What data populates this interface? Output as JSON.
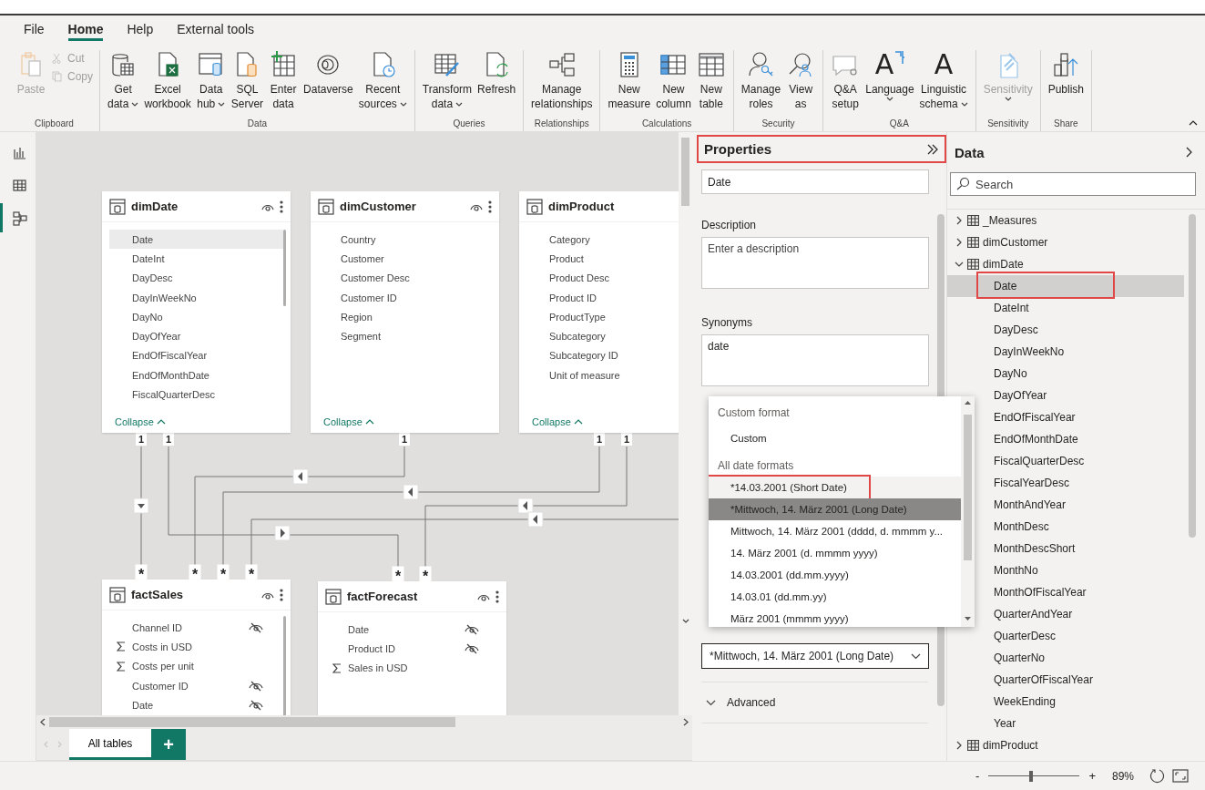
{
  "menu_tabs": [
    {
      "label": "File",
      "selected": false
    },
    {
      "label": "Home",
      "selected": true
    },
    {
      "label": "Help",
      "selected": false
    },
    {
      "label": "External tools",
      "selected": false
    }
  ],
  "ribbon": {
    "groups": [
      {
        "label": "Clipboard",
        "buttons": [
          {
            "kind": "large",
            "label": "Paste",
            "disabled": true,
            "dropdown": false
          },
          {
            "kind": "small",
            "label": "Cut",
            "disabled": true,
            "dropdown": false
          },
          {
            "kind": "small",
            "label": "Copy",
            "disabled": true,
            "dropdown": false
          }
        ]
      },
      {
        "label": "Data",
        "buttons": [
          {
            "kind": "large",
            "label": "Get\ndata",
            "disabled": false,
            "dropdown": true
          },
          {
            "kind": "large",
            "label": "Excel\nworkbook",
            "disabled": false,
            "dropdown": false
          },
          {
            "kind": "large",
            "label": "Data\nhub",
            "disabled": false,
            "dropdown": true
          },
          {
            "kind": "large",
            "label": "SQL\nServer",
            "disabled": false,
            "dropdown": false
          },
          {
            "kind": "large",
            "label": "Enter\ndata",
            "disabled": false,
            "dropdown": false
          },
          {
            "kind": "large",
            "label": "Dataverse",
            "disabled": false,
            "dropdown": false
          },
          {
            "kind": "large",
            "label": "Recent\nsources",
            "disabled": false,
            "dropdown": true
          }
        ]
      },
      {
        "label": "Queries",
        "buttons": [
          {
            "kind": "large",
            "label": "Transform\ndata",
            "disabled": false,
            "dropdown": true
          },
          {
            "kind": "large",
            "label": "Refresh",
            "disabled": false,
            "dropdown": false
          }
        ]
      },
      {
        "label": "Relationships",
        "buttons": [
          {
            "kind": "large",
            "label": "Manage\nrelationships",
            "disabled": false,
            "dropdown": false
          }
        ]
      },
      {
        "label": "Calculations",
        "buttons": [
          {
            "kind": "large",
            "label": "New\nmeasure",
            "disabled": false,
            "dropdown": false
          },
          {
            "kind": "large",
            "label": "New\ncolumn",
            "disabled": false,
            "dropdown": false
          },
          {
            "kind": "large",
            "label": "New\ntable",
            "disabled": false,
            "dropdown": false
          }
        ]
      },
      {
        "label": "Security",
        "buttons": [
          {
            "kind": "large",
            "label": "Manage\nroles",
            "disabled": false,
            "dropdown": false
          },
          {
            "kind": "large",
            "label": "View\nas",
            "disabled": false,
            "dropdown": false
          }
        ]
      },
      {
        "label": "Q&A",
        "buttons": [
          {
            "kind": "large",
            "label": "Q&A\nsetup",
            "disabled": false,
            "dropdown": false
          },
          {
            "kind": "large",
            "label": "Language",
            "disabled": false,
            "dropdown": true,
            "icon_text": "A"
          },
          {
            "kind": "large",
            "label": "Linguistic\nschema",
            "disabled": false,
            "dropdown": true,
            "icon_text": "A"
          }
        ]
      },
      {
        "label": "Sensitivity",
        "buttons": [
          {
            "kind": "large",
            "label": "Sensitivity",
            "disabled": true,
            "dropdown": true
          }
        ]
      },
      {
        "label": "Share",
        "buttons": [
          {
            "kind": "large",
            "label": "Publish",
            "disabled": false,
            "dropdown": false
          }
        ]
      }
    ]
  },
  "sidebar": {
    "views": [
      {
        "selected": false
      },
      {
        "selected": false
      },
      {
        "selected": true
      }
    ]
  },
  "diagram": {
    "tables": [
      {
        "name": "dimDate",
        "collapse_label": "Collapse",
        "fields": [
          {
            "name": "Date",
            "selected": true
          },
          {
            "name": "DateInt",
            "selected": false
          },
          {
            "name": "DayDesc",
            "selected": false
          },
          {
            "name": "DayInWeekNo",
            "selected": false
          },
          {
            "name": "DayNo",
            "selected": false
          },
          {
            "name": "DayOfYear",
            "selected": false
          },
          {
            "name": "EndOfFiscalYear",
            "selected": false
          },
          {
            "name": "EndOfMonthDate",
            "selected": false
          },
          {
            "name": "FiscalQuarterDesc",
            "selected": false
          }
        ]
      },
      {
        "name": "dimCustomer",
        "collapse_label": "Collapse",
        "fields": [
          {
            "name": "Country",
            "selected": false
          },
          {
            "name": "Customer",
            "selected": false
          },
          {
            "name": "Customer Desc",
            "selected": false
          },
          {
            "name": "Customer ID",
            "selected": false
          },
          {
            "name": "Region",
            "selected": false
          },
          {
            "name": "Segment",
            "selected": false
          }
        ]
      },
      {
        "name": "dimProduct",
        "collapse_label": "Collapse",
        "fields": [
          {
            "name": "Category",
            "selected": false
          },
          {
            "name": "Product",
            "selected": false
          },
          {
            "name": "Product Desc",
            "selected": false
          },
          {
            "name": "Product ID",
            "selected": false
          },
          {
            "name": "ProductType",
            "selected": false
          },
          {
            "name": "Subcategory",
            "selected": false
          },
          {
            "name": "Subcategory ID",
            "selected": false
          },
          {
            "name": "Unit of measure",
            "selected": false
          }
        ]
      },
      {
        "name": "factSales",
        "fields": [
          {
            "name": "Channel ID",
            "selected": false,
            "hidden": true
          },
          {
            "name": "Costs in USD",
            "selected": false,
            "sum": true
          },
          {
            "name": "Costs per unit",
            "selected": false,
            "sum": true
          },
          {
            "name": "Customer ID",
            "selected": false,
            "hidden": true
          },
          {
            "name": "Date",
            "selected": false,
            "hidden": true
          }
        ]
      },
      {
        "name": "factForecast",
        "fields": [
          {
            "name": "Date",
            "selected": false,
            "hidden": true
          },
          {
            "name": "Product ID",
            "selected": false,
            "hidden": true
          },
          {
            "name": "Sales in USD",
            "selected": false,
            "sum": true
          }
        ]
      }
    ],
    "relationships": [
      {
        "kind": "down"
      },
      {
        "kind": "right"
      },
      {
        "kind": "left"
      },
      {
        "kind": "left"
      },
      {
        "kind": "left"
      },
      {
        "kind": "left"
      }
    ],
    "one_side_labels": [
      "1",
      "1",
      "1",
      "1",
      "1"
    ],
    "many_side_labels": [
      "*",
      "*",
      "*",
      "*",
      "*",
      "*"
    ]
  },
  "page_tabs": {
    "tabs": [
      {
        "label": "All tables",
        "selected": true
      }
    ],
    "add_label": "+"
  },
  "properties": {
    "title": "Properties",
    "highlighted": true,
    "name_value": "Date",
    "description": {
      "label": "Description",
      "placeholder": "Enter a description"
    },
    "synonyms": {
      "label": "Synonyms",
      "value": "date"
    },
    "format_value": "*Mittwoch, 14. März 2001 (Long Date)",
    "advanced": {
      "label": "Advanced",
      "expanded": false
    }
  },
  "format_menu": {
    "items": [
      {
        "kind": "header",
        "label": "Custom format"
      },
      {
        "kind": "option",
        "label": "Custom",
        "selected": false,
        "highlighted": false
      },
      {
        "kind": "header",
        "label": "All date formats"
      },
      {
        "kind": "option",
        "label": "*14.03.2001 (Short Date)",
        "selected": false,
        "highlighted": true
      },
      {
        "kind": "option",
        "label": "*Mittwoch, 14. März 2001 (Long Date)",
        "selected": true,
        "highlighted": false
      },
      {
        "kind": "option",
        "label": "Mittwoch, 14. März 2001 (dddd, d. mmmm y...",
        "selected": false,
        "highlighted": false
      },
      {
        "kind": "option",
        "label": "14. März 2001 (d. mmmm yyyy)",
        "selected": false,
        "highlighted": false
      },
      {
        "kind": "option",
        "label": "14.03.2001 (dd.mm.yyyy)",
        "selected": false,
        "highlighted": false
      },
      {
        "kind": "option",
        "label": "14.03.01 (dd.mm.yy)",
        "selected": false,
        "highlighted": false
      },
      {
        "kind": "option",
        "label": "März 2001 (mmmm yyyy)",
        "selected": false,
        "highlighted": false
      }
    ]
  },
  "data_pane": {
    "title": "Data",
    "search_placeholder": "Search",
    "tables": [
      {
        "name": "_Measures",
        "expanded": false
      },
      {
        "name": "dimCustomer",
        "expanded": false
      },
      {
        "name": "dimDate",
        "expanded": true,
        "fields": [
          {
            "name": "Date",
            "selected": true,
            "highlighted": true
          },
          {
            "name": "DateInt",
            "selected": false,
            "highlighted": false
          },
          {
            "name": "DayDesc",
            "selected": false,
            "highlighted": false
          },
          {
            "name": "DayInWeekNo",
            "selected": false,
            "highlighted": false
          },
          {
            "name": "DayNo",
            "selected": false,
            "highlighted": false
          },
          {
            "name": "DayOfYear",
            "selected": false,
            "highlighted": false
          },
          {
            "name": "EndOfFiscalYear",
            "selected": false,
            "highlighted": false
          },
          {
            "name": "EndOfMonthDate",
            "selected": false,
            "highlighted": false
          },
          {
            "name": "FiscalQuarterDesc",
            "selected": false,
            "highlighted": false
          },
          {
            "name": "FiscalYearDesc",
            "selected": false,
            "highlighted": false
          },
          {
            "name": "MonthAndYear",
            "selected": false,
            "highlighted": false
          },
          {
            "name": "MonthDesc",
            "selected": false,
            "highlighted": false
          },
          {
            "name": "MonthDescShort",
            "selected": false,
            "highlighted": false
          },
          {
            "name": "MonthNo",
            "selected": false,
            "highlighted": false
          },
          {
            "name": "MonthOfFiscalYear",
            "selected": false,
            "highlighted": false
          },
          {
            "name": "QuarterAndYear",
            "selected": false,
            "highlighted": false
          },
          {
            "name": "QuarterDesc",
            "selected": false,
            "highlighted": false
          },
          {
            "name": "QuarterNo",
            "selected": false,
            "highlighted": false
          },
          {
            "name": "QuarterOfFiscalYear",
            "selected": false,
            "highlighted": false
          },
          {
            "name": "WeekEnding",
            "selected": false,
            "highlighted": false
          },
          {
            "name": "Year",
            "selected": false,
            "highlighted": false
          }
        ]
      },
      {
        "name": "dimProduct",
        "expanded": false
      }
    ]
  },
  "status_bar": {
    "zoom": {
      "minus": "-",
      "plus": "+",
      "level": 0.47,
      "reading": "89%"
    }
  }
}
